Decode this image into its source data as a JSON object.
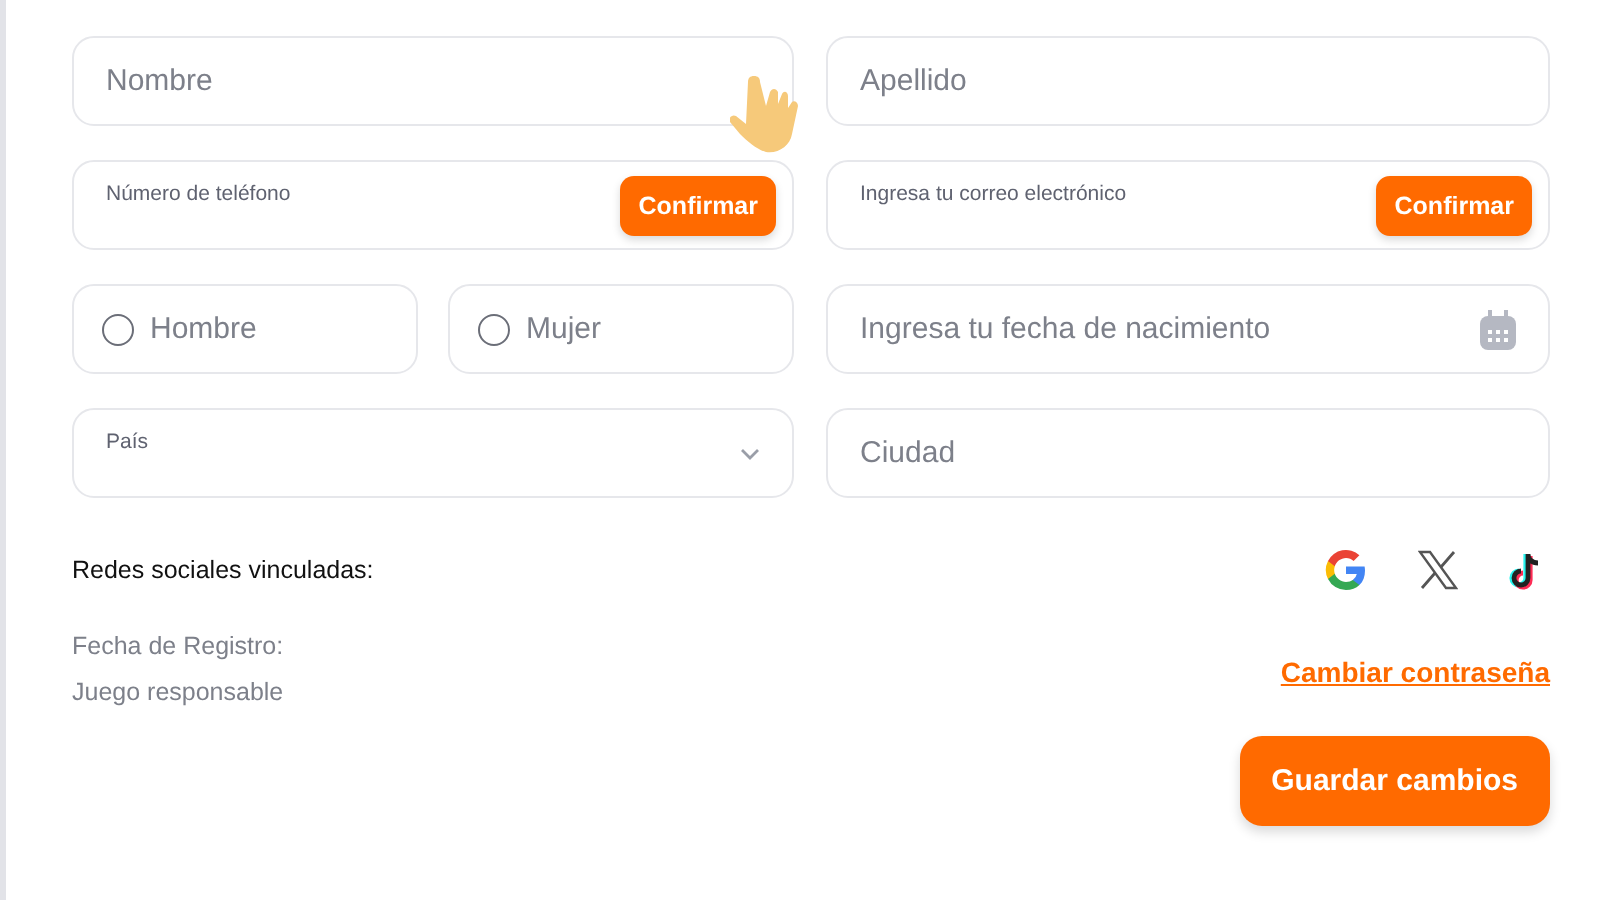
{
  "first_name": {
    "placeholder": "Nombre"
  },
  "last_name": {
    "placeholder": "Apellido"
  },
  "phone": {
    "label": "Número de teléfono",
    "button": "Confirmar"
  },
  "email": {
    "label": "Ingresa tu correo electrónico",
    "button": "Confirmar"
  },
  "gender": [
    {
      "label": "Hombre",
      "selected": false
    },
    {
      "label": "Mujer",
      "selected": false
    }
  ],
  "birth_date": {
    "placeholder": "Ingresa tu fecha de nacimiento"
  },
  "country": {
    "label": "País"
  },
  "city": {
    "placeholder": "Ciudad"
  },
  "social": {
    "label": "Redes sociales vinculadas:",
    "networks": [
      {
        "kind": "google"
      },
      {
        "kind": "x"
      },
      {
        "kind": "tiktok"
      }
    ]
  },
  "registration_date": "Fecha de Registro:",
  "responsible_gaming": "Juego responsable",
  "change_password": "Cambiar contraseña",
  "save_button": "Guardar cambios"
}
